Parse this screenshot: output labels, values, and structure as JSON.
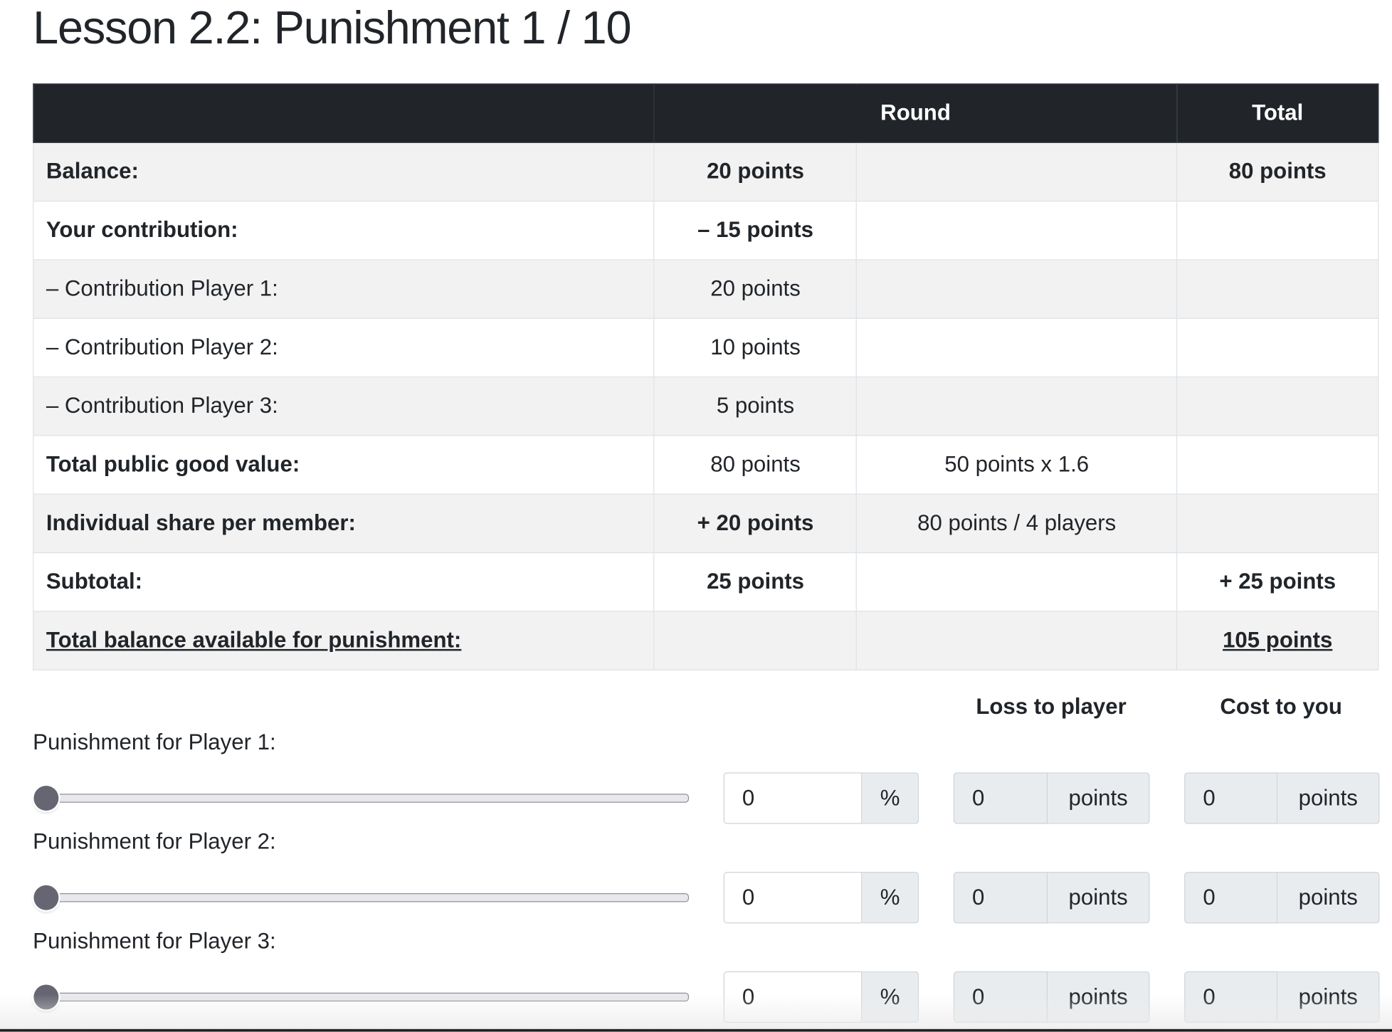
{
  "title": "Lesson 2.2: Punishment 1 / 10",
  "table": {
    "headers": [
      "",
      "Round",
      "Total"
    ],
    "rows": [
      {
        "label": "Balance:",
        "round": "20 points",
        "note": "",
        "total": "80 points",
        "bold": true
      },
      {
        "label": "Your contribution:",
        "round": "– 15 points",
        "note": "",
        "total": "",
        "bold": true
      },
      {
        "label": "– Contribution Player 1:",
        "round": "20 points",
        "note": "",
        "total": "",
        "bold": false
      },
      {
        "label": "– Contribution Player 2:",
        "round": "10 points",
        "note": "",
        "total": "",
        "bold": false
      },
      {
        "label": "– Contribution Player 3:",
        "round": "5 points",
        "note": "",
        "total": "",
        "bold": false
      },
      {
        "label": "Total public good value:",
        "round": "80 points",
        "note": "50 points x 1.6",
        "total": "",
        "bold": "label"
      },
      {
        "label": "Individual share per member:",
        "round": "+ 20 points",
        "note": "80 points / 4 players",
        "total": "",
        "bold": "labelround"
      },
      {
        "label": "Subtotal:",
        "round": "25 points",
        "note": "",
        "total": "+ 25 points",
        "bold": true
      },
      {
        "label": "Total balance available for punishment:",
        "round": "",
        "note": "",
        "total": "105 points",
        "bold": true
      }
    ]
  },
  "punishment": {
    "loss_header": "Loss to player",
    "cost_header": "Cost to you",
    "players": [
      {
        "label": "Punishment for Player 1:",
        "slider_value": 0,
        "percent": "0",
        "percent_unit": "%",
        "loss": "0",
        "loss_unit": "points",
        "cost": "0",
        "cost_unit": "points"
      },
      {
        "label": "Punishment for Player 2:",
        "slider_value": 0,
        "percent": "0",
        "percent_unit": "%",
        "loss": "0",
        "loss_unit": "points",
        "cost": "0",
        "cost_unit": "points"
      },
      {
        "label": "Punishment for Player 3:",
        "slider_value": 0,
        "percent": "0",
        "percent_unit": "%",
        "loss": "0",
        "loss_unit": "points",
        "cost": "0",
        "cost_unit": "points"
      }
    ]
  }
}
